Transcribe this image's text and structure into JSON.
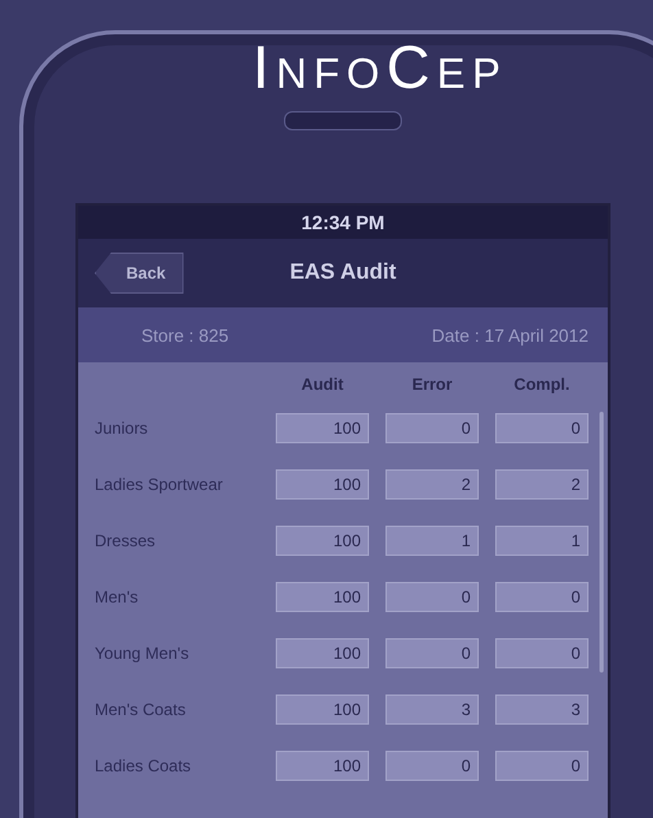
{
  "logo": "InfoCep",
  "status_bar": {
    "time": "12:34 PM"
  },
  "nav_bar": {
    "back": "Back",
    "title": "EAS Audit"
  },
  "info": {
    "store": "Store : 825",
    "date": "Date : 17 April 2012"
  },
  "table": {
    "columns": [
      "Audit",
      "Error",
      "Compl."
    ],
    "rows": [
      {
        "name": "Juniors",
        "values": [
          "100",
          "0",
          "0"
        ]
      },
      {
        "name": "Ladies Sportwear",
        "values": [
          "100",
          "2",
          "2"
        ]
      },
      {
        "name": "Dresses",
        "values": [
          "100",
          "1",
          "1"
        ]
      },
      {
        "name": "Men's",
        "values": [
          "100",
          "0",
          "0"
        ]
      },
      {
        "name": "Young Men's",
        "values": [
          "100",
          "0",
          "0"
        ]
      },
      {
        "name": "Men's Coats",
        "values": [
          "100",
          "3",
          "3"
        ]
      },
      {
        "name": "Ladies Coats",
        "values": [
          "100",
          "0",
          "0"
        ]
      }
    ]
  }
}
